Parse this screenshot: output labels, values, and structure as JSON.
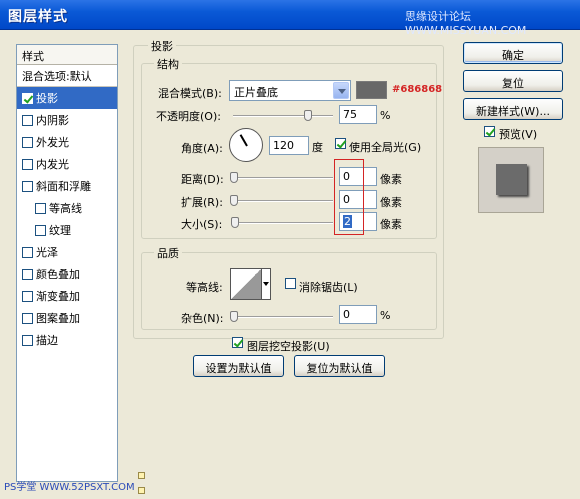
{
  "window": {
    "title": "图层样式",
    "watermark": "思缘设计论坛 WWW.MISSYUAN.COM"
  },
  "styles_list": {
    "header": "样式",
    "blend_options": "混合选项:默认",
    "items": [
      {
        "label": "投影",
        "checked": true,
        "selected": true
      },
      {
        "label": "内阴影",
        "checked": false
      },
      {
        "label": "外发光",
        "checked": false
      },
      {
        "label": "内发光",
        "checked": false
      },
      {
        "label": "斜面和浮雕",
        "checked": false
      },
      {
        "label": "等高线",
        "checked": false,
        "sub": true
      },
      {
        "label": "纹理",
        "checked": false,
        "sub": true
      },
      {
        "label": "光泽",
        "checked": false
      },
      {
        "label": "颜色叠加",
        "checked": false
      },
      {
        "label": "渐变叠加",
        "checked": false
      },
      {
        "label": "图案叠加",
        "checked": false
      },
      {
        "label": "描边",
        "checked": false
      }
    ]
  },
  "drop_shadow": {
    "group_title": "投影",
    "structure": {
      "title": "结构",
      "blend_mode_label": "混合模式(B):",
      "blend_mode_value": "正片叠底",
      "color_hex": "#686868",
      "color_label": "#686868",
      "opacity_label": "不透明度(O):",
      "opacity_value": "75",
      "opacity_fraction": 0.75,
      "percent": "%",
      "angle_label": "角度(A):",
      "angle_value": "120",
      "degree": "度",
      "use_global_light": "使用全局光(G)",
      "use_global_light_checked": true,
      "distance_label": "距离(D):",
      "distance_value": "0",
      "spread_label": "扩展(R):",
      "spread_value": "0",
      "size_label": "大小(S):",
      "size_value": "2",
      "pixels": "像素"
    },
    "quality": {
      "title": "品质",
      "contour_label": "等高线:",
      "anti_alias": "消除锯齿(L)",
      "anti_alias_checked": false,
      "noise_label": "杂色(N):",
      "noise_value": "0",
      "percent": "%"
    },
    "knockout": "图层挖空投影(U)",
    "knockout_checked": true,
    "make_default": "设置为默认值",
    "reset_default": "复位为默认值"
  },
  "right_panel": {
    "ok": "确定",
    "reset": "复位",
    "new_style": "新建样式(W)...",
    "preview_label": "预览(V)",
    "preview_checked": true
  },
  "footer": {
    "mark": "PS学堂 WWW.52PSXT.COM"
  }
}
